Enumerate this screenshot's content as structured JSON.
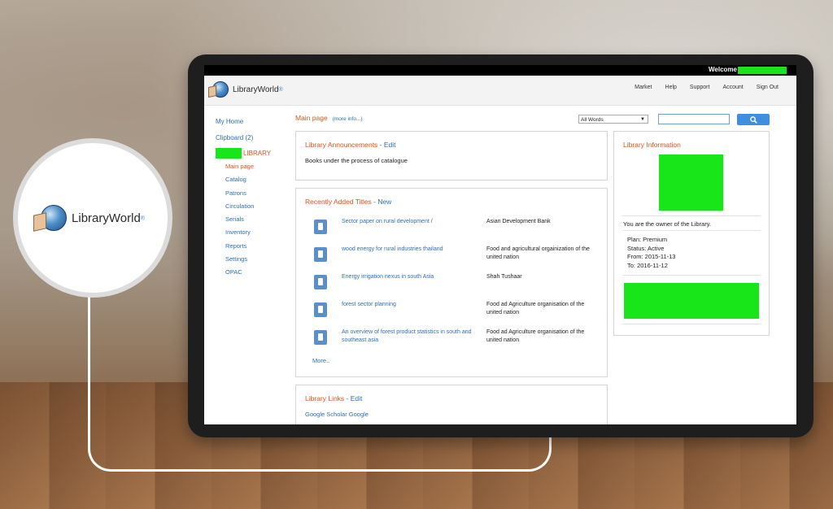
{
  "hero_logo": {
    "brand": "LibraryWorld",
    "reg": "®"
  },
  "app": {
    "welcome": "Welcome",
    "brand": "LibraryWorld",
    "reg": "®",
    "nav": [
      "Market",
      "Help",
      "Support",
      "Account",
      "Sign Out"
    ]
  },
  "sidebar": {
    "my_home": "My Home",
    "clipboard": "Clipboard (2)",
    "library_suffix": "LIBRARY",
    "items": [
      "Main page",
      "Catalog",
      "Patrons",
      "Circulation",
      "Serials",
      "Inventory",
      "Reports",
      "Settings",
      "OPAC"
    ],
    "active": "Main page"
  },
  "main": {
    "title": "Main page",
    "more_info": "(more info...)",
    "search_scope": "All Words",
    "search_value": ""
  },
  "announcements": {
    "title": "Library Announcements",
    "sep": " - ",
    "edit": "Edit",
    "text": "Books under the process of catalogue"
  },
  "recent": {
    "title": "Recently Added Titles",
    "sep": " - ",
    "new": "New",
    "items": [
      {
        "title": "Sector paper on rural development /",
        "author": "Asian Development Bank"
      },
      {
        "title": "wood energy for rural industries thailand",
        "author": "Food and agricultural orgainization of the united nation"
      },
      {
        "title": "Energy irrigation nexus in south Asia",
        "author": "Shah Tushaar"
      },
      {
        "title": "forest sector planning",
        "author": "Food ad Agriculture organisation of the united nation"
      },
      {
        "title": "An overview of forest product statistics in south and southeast asia",
        "author": "Food ad Agriculture organisation of the united nation"
      }
    ],
    "more": "More.."
  },
  "links": {
    "title": "Library Links",
    "sep": " - ",
    "edit": "Edit",
    "text": "Google Scholar Google"
  },
  "info": {
    "title": "Library Information",
    "owner": "You are the owner of the Library.",
    "plan": "Plan: Premium",
    "status": "Status: Active",
    "from": "From: 2015-11-13",
    "to": "To: 2016-11-12"
  },
  "colors": {
    "accent_orange": "#e0531f",
    "link_blue": "#2d6fb7",
    "redaction_green": "#19e619",
    "search_button": "#3f8edf"
  }
}
